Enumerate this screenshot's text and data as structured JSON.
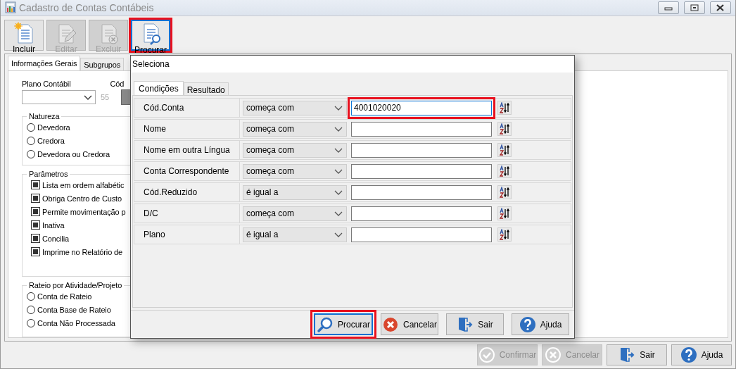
{
  "window": {
    "title": "Cadastro de Contas Contábeis"
  },
  "toolbar": [
    {
      "label": "Incluir",
      "kind": "new",
      "disabled": false,
      "highlighted": false
    },
    {
      "label": "Editar",
      "kind": "edit",
      "disabled": true,
      "highlighted": false
    },
    {
      "label": "Excluir",
      "kind": "delete",
      "disabled": true,
      "highlighted": false
    },
    {
      "label": "Procurar",
      "kind": "search",
      "disabled": false,
      "highlighted": true
    }
  ],
  "main_tabs": [
    {
      "label": "Informações Gerais",
      "selected": true
    },
    {
      "label": "Subgrupos",
      "selected": false
    }
  ],
  "form": {
    "plano_label": "Plano Contábil",
    "plano_count": "55",
    "cod_label": "Cód",
    "natureza": {
      "title": "Natureza",
      "options": [
        {
          "label": "Devedora",
          "selected": false
        },
        {
          "label": "Credora",
          "selected": false
        },
        {
          "label": "Devedora ou Credora",
          "selected": false
        }
      ]
    },
    "parametros": {
      "title": "Parâmetros",
      "options": [
        {
          "label": "Lista em ordem alfabétic",
          "checked": true
        },
        {
          "label": "Obriga Centro de Custo",
          "checked": true
        },
        {
          "label": "Permite movimentação p",
          "checked": true
        },
        {
          "label": "Inativa",
          "checked": true
        },
        {
          "label": "Concilia",
          "checked": true
        },
        {
          "label": "Imprime no Relatório de",
          "checked": true
        }
      ]
    },
    "rateio": {
      "title": "Rateio por Atividade/Projeto",
      "options": [
        {
          "label": "Conta de Rateio",
          "selected": false
        },
        {
          "label": "Conta Base de Rateio",
          "selected": false
        },
        {
          "label": "Conta Não Processada",
          "selected": false
        }
      ]
    }
  },
  "dialog": {
    "title": "Seleciona",
    "tabs": [
      {
        "label": "Condições",
        "selected": true
      },
      {
        "label": "Resultado",
        "selected": false
      }
    ],
    "conditions": [
      {
        "field": "Cód.Conta",
        "operator": "começa com",
        "value": "4001020020",
        "highlighted": true
      },
      {
        "field": "Nome",
        "operator": "começa com",
        "highlighted": false
      },
      {
        "field": "Nome em outra Língua",
        "operator": "começa com",
        "highlighted": false
      },
      {
        "field": "Conta Correspondente",
        "operator": "começa com",
        "highlighted": false
      },
      {
        "field": "Cód.Reduzido",
        "operator": "é igual a",
        "highlighted": false
      },
      {
        "field": "D/C",
        "operator": "começa com",
        "highlighted": false
      },
      {
        "field": "Plano",
        "operator": "é igual a",
        "highlighted": false
      }
    ],
    "buttons": [
      {
        "label": "Procurar",
        "kind": "search",
        "highlighted": true
      },
      {
        "label": "Cancelar",
        "kind": "cancel",
        "highlighted": false
      },
      {
        "label": "Sair",
        "kind": "exit",
        "highlighted": false
      },
      {
        "label": "Ajuda",
        "kind": "help",
        "highlighted": false
      }
    ]
  },
  "footer_buttons": [
    {
      "label": "Confirmar",
      "kind": "confirm",
      "disabled": true
    },
    {
      "label": "Cancelar",
      "kind": "cancel",
      "disabled": true
    },
    {
      "label": "Sair",
      "kind": "exit",
      "disabled": false
    },
    {
      "label": "Ajuda",
      "kind": "help",
      "disabled": false
    }
  ]
}
